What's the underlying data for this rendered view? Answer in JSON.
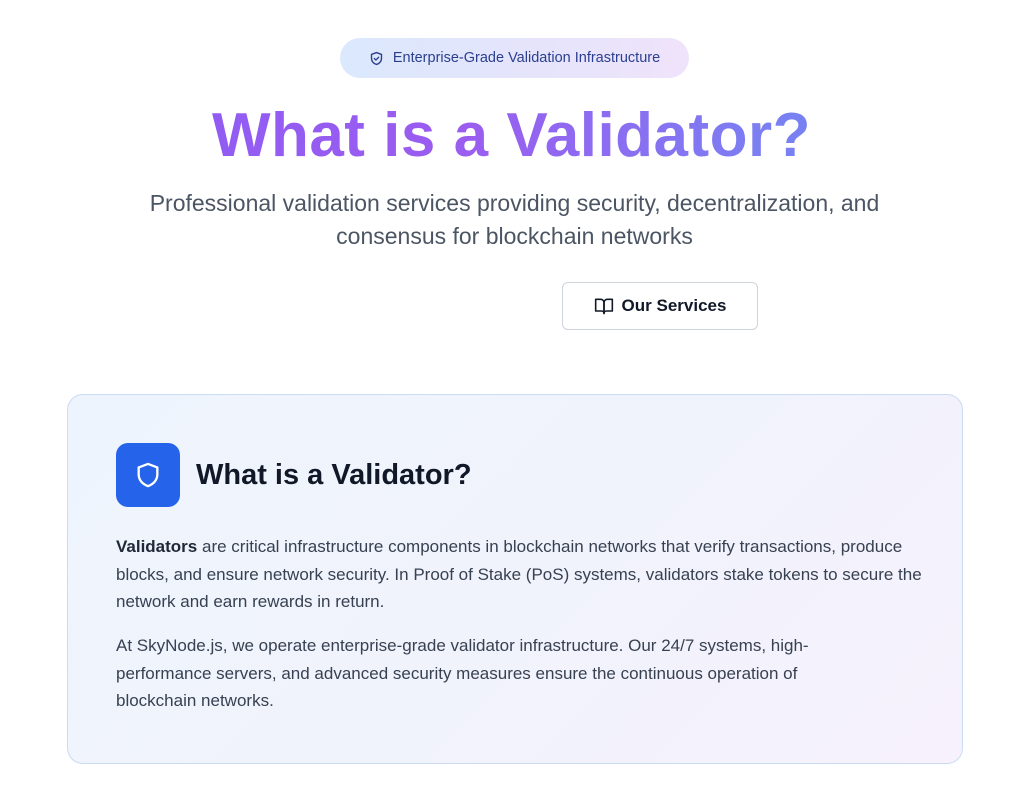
{
  "hero": {
    "badge_label": "Enterprise-Grade Validation Infrastructure",
    "badge_icon": "shield-check-icon",
    "title": "What is a Validator?",
    "subtitle": "Professional validation services providing security, decentralization, and consensus for blockchain networks",
    "services_button_label": "Our Services",
    "services_button_icon": "book-open-icon"
  },
  "card": {
    "icon": "shield-icon",
    "title": "What is a Validator?",
    "p1_bold": "Validators",
    "p1_rest": " are critical infrastructure components in blockchain networks that verify transactions, produce blocks, and ensure network security. In Proof of Stake (PoS) systems, validators stake tokens to secure the network and earn rewards in return.",
    "p2": "At SkyNode.js, we operate enterprise-grade validator infrastructure. Our 24/7 systems, high-performance servers, and advanced security measures ensure the continuous operation of blockchain networks."
  },
  "colors": {
    "accent_blue": "#2563eb",
    "title_gradient_start": "#8a5cf5",
    "title_gradient_end": "#5f8cf0",
    "badge_text": "#2b3f8f"
  }
}
